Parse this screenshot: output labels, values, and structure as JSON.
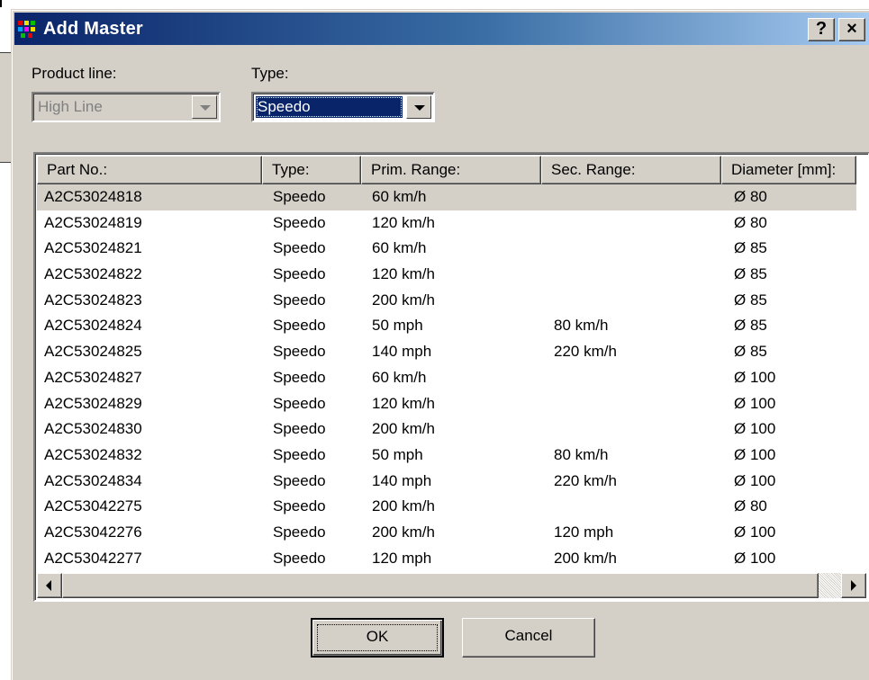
{
  "window": {
    "title": "Add Master",
    "help_label": "?",
    "close_label": "×"
  },
  "filters": {
    "product_line_label": "Product line:",
    "product_line_value": "High Line",
    "type_label": "Type:",
    "type_value": "Speedo"
  },
  "list": {
    "columns": [
      "Part No.:",
      "Type:",
      "Prim. Range:",
      "Sec. Range:",
      "Diameter [mm]:"
    ],
    "rows": [
      [
        "A2C53024818",
        "Speedo",
        "60 km/h",
        "",
        "Ø 80"
      ],
      [
        "A2C53024819",
        "Speedo",
        "120 km/h",
        "",
        "Ø 80"
      ],
      [
        "A2C53024821",
        "Speedo",
        "60 km/h",
        "",
        "Ø 85"
      ],
      [
        "A2C53024822",
        "Speedo",
        "120 km/h",
        "",
        "Ø 85"
      ],
      [
        "A2C53024823",
        "Speedo",
        "200 km/h",
        "",
        "Ø 85"
      ],
      [
        "A2C53024824",
        "Speedo",
        "50 mph",
        "80 km/h",
        "Ø 85"
      ],
      [
        "A2C53024825",
        "Speedo",
        "140 mph",
        "220 km/h",
        "Ø 85"
      ],
      [
        "A2C53024827",
        "Speedo",
        "60 km/h",
        "",
        "Ø 100"
      ],
      [
        "A2C53024829",
        "Speedo",
        "120 km/h",
        "",
        "Ø 100"
      ],
      [
        "A2C53024830",
        "Speedo",
        "200 km/h",
        "",
        "Ø 100"
      ],
      [
        "A2C53024832",
        "Speedo",
        "50 mph",
        "80 km/h",
        "Ø 100"
      ],
      [
        "A2C53024834",
        "Speedo",
        "140 mph",
        "220 km/h",
        "Ø 100"
      ],
      [
        "A2C53042275",
        "Speedo",
        "200 km/h",
        "",
        "Ø 80"
      ],
      [
        "A2C53042276",
        "Speedo",
        "200 km/h",
        "120 mph",
        "Ø 100"
      ],
      [
        "A2C53042277",
        "Speedo",
        "120 mph",
        "200 km/h",
        "Ø 100"
      ]
    ]
  },
  "buttons": {
    "ok_label": "OK",
    "cancel_label": "Cancel"
  },
  "colors": {
    "title_gradient_start": "#0a246a",
    "title_gradient_end": "#a6caf0",
    "face": "#d4d0c8",
    "selection": "#0a246a"
  }
}
